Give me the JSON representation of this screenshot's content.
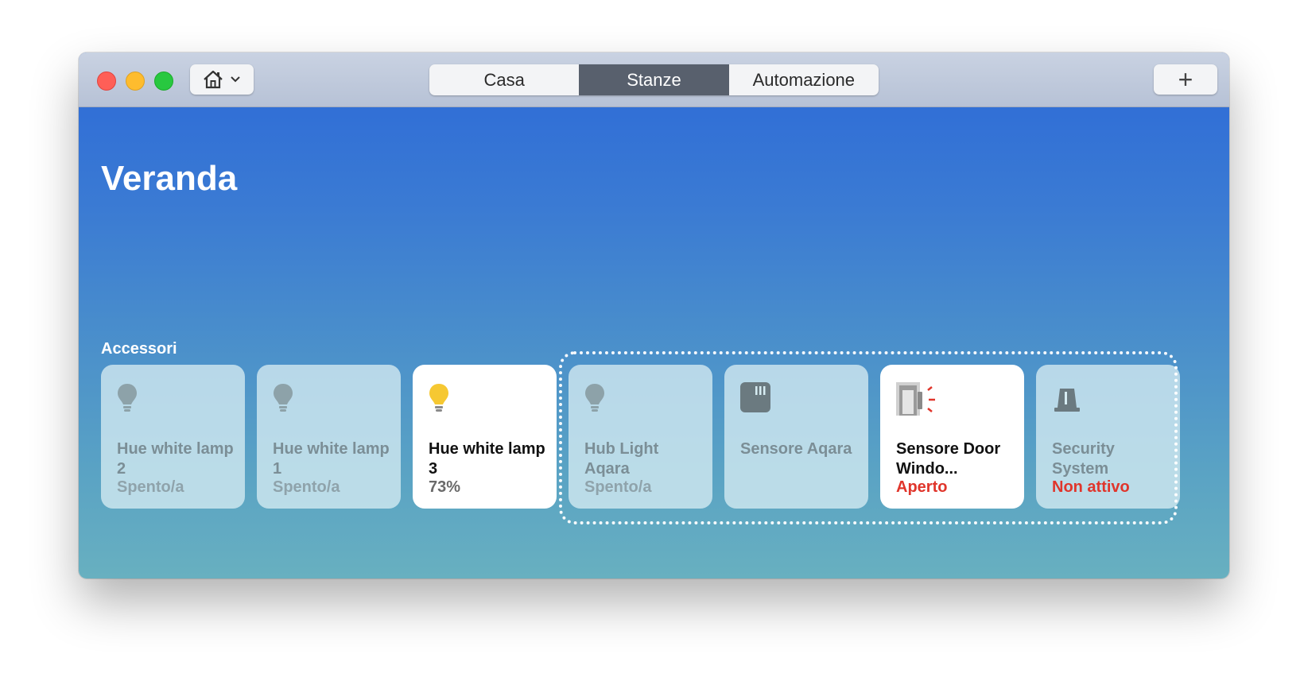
{
  "toolbar": {
    "home_menu_icon": "house-icon",
    "tabs": [
      {
        "label": "Casa",
        "active": false
      },
      {
        "label": "Stanze",
        "active": true
      },
      {
        "label": "Automazione",
        "active": false
      }
    ],
    "add_label": "+"
  },
  "room": {
    "title": "Veranda",
    "section_label": "Accessori"
  },
  "accessories": [
    {
      "name": "Hue white lamp 2",
      "status": "Spento/a",
      "on": false,
      "icon": "lightbulb-icon"
    },
    {
      "name": "Hue white lamp 1",
      "status": "Spento/a",
      "on": false,
      "icon": "lightbulb-icon"
    },
    {
      "name": "Hue white lamp 3",
      "status": "73%",
      "on": true,
      "icon": "lightbulb-icon"
    },
    {
      "name": "Hub Light Aqara",
      "status": "Spento/a",
      "on": false,
      "icon": "lightbulb-icon"
    },
    {
      "name": "Sensore Aqara",
      "status": "",
      "on": false,
      "icon": "sensor-icon"
    },
    {
      "name": "Sensore Door Windo...",
      "status": "Aperto",
      "on": true,
      "icon": "door-sensor-icon"
    },
    {
      "name": "Security System",
      "status": "Non attivo",
      "on": false,
      "icon": "alarm-icon"
    }
  ],
  "colors": {
    "bulb_on": "#f6c832",
    "alert": "#e0352b",
    "active_tab": "#58606d"
  }
}
